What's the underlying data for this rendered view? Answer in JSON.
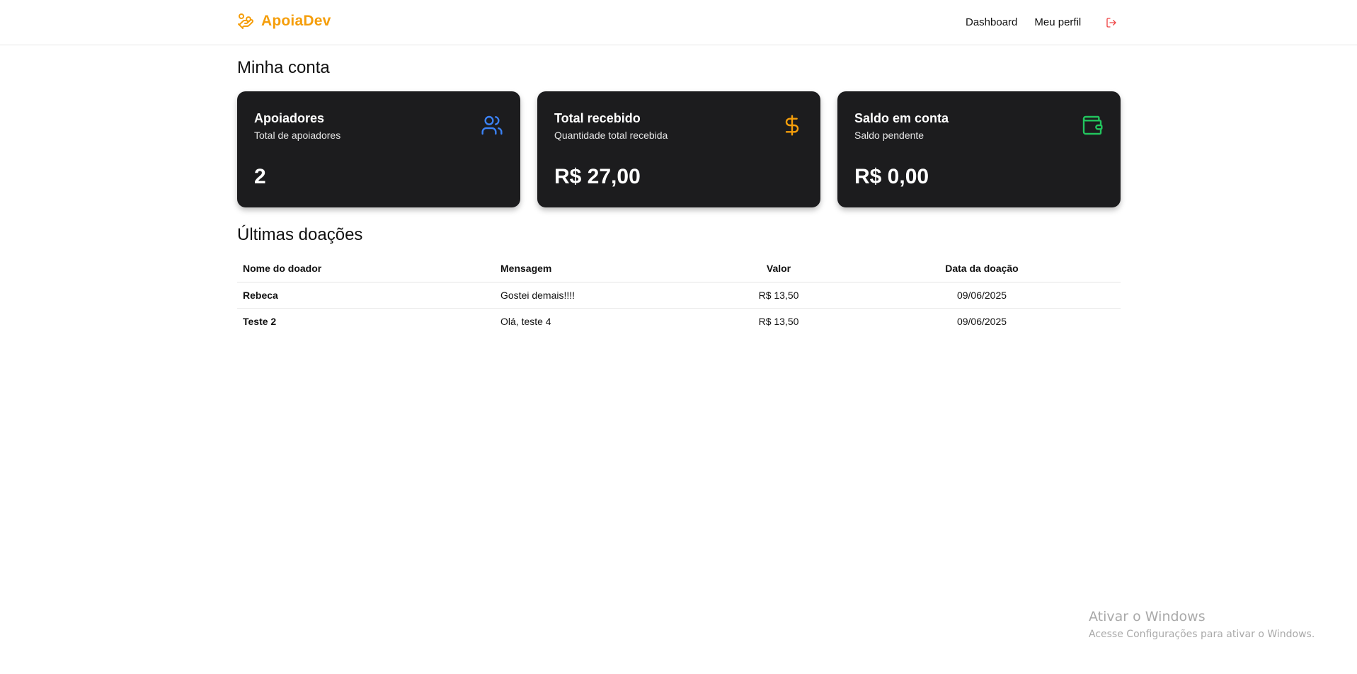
{
  "header": {
    "brand": "ApoiaDev",
    "nav": [
      "Dashboard",
      "Meu perfil"
    ],
    "logout_icon": "logout-icon"
  },
  "colors": {
    "brand": "#f59e0b",
    "users_icon": "#3b82f6",
    "dollar_icon": "#f59e0b",
    "wallet_icon": "#22c55e",
    "logout_icon": "#ef4444",
    "card_bg": "#1c1c1e"
  },
  "page_title": "Minha conta",
  "cards": [
    {
      "title": "Apoiadores",
      "subtitle": "Total de apoiadores",
      "value": "2",
      "icon": "users-icon"
    },
    {
      "title": "Total recebido",
      "subtitle": "Quantidade total recebida",
      "value": "R$ 27,00",
      "icon": "dollar-icon"
    },
    {
      "title": "Saldo em conta",
      "subtitle": "Saldo pendente",
      "value": "R$ 0,00",
      "icon": "wallet-icon"
    }
  ],
  "donations": {
    "title": "Últimas doações",
    "columns": [
      "Nome do doador",
      "Mensagem",
      "Valor",
      "Data da doação"
    ],
    "rows": [
      {
        "name": "Rebeca",
        "message": "Gostei demais!!!!",
        "value": "R$ 13,50",
        "date": "09/06/2025"
      },
      {
        "name": "Teste 2",
        "message": "Olá, teste 4",
        "value": "R$ 13,50",
        "date": "09/06/2025"
      }
    ]
  },
  "watermark": {
    "title": "Ativar o Windows",
    "subtitle": "Acesse Configurações para ativar o Windows."
  }
}
